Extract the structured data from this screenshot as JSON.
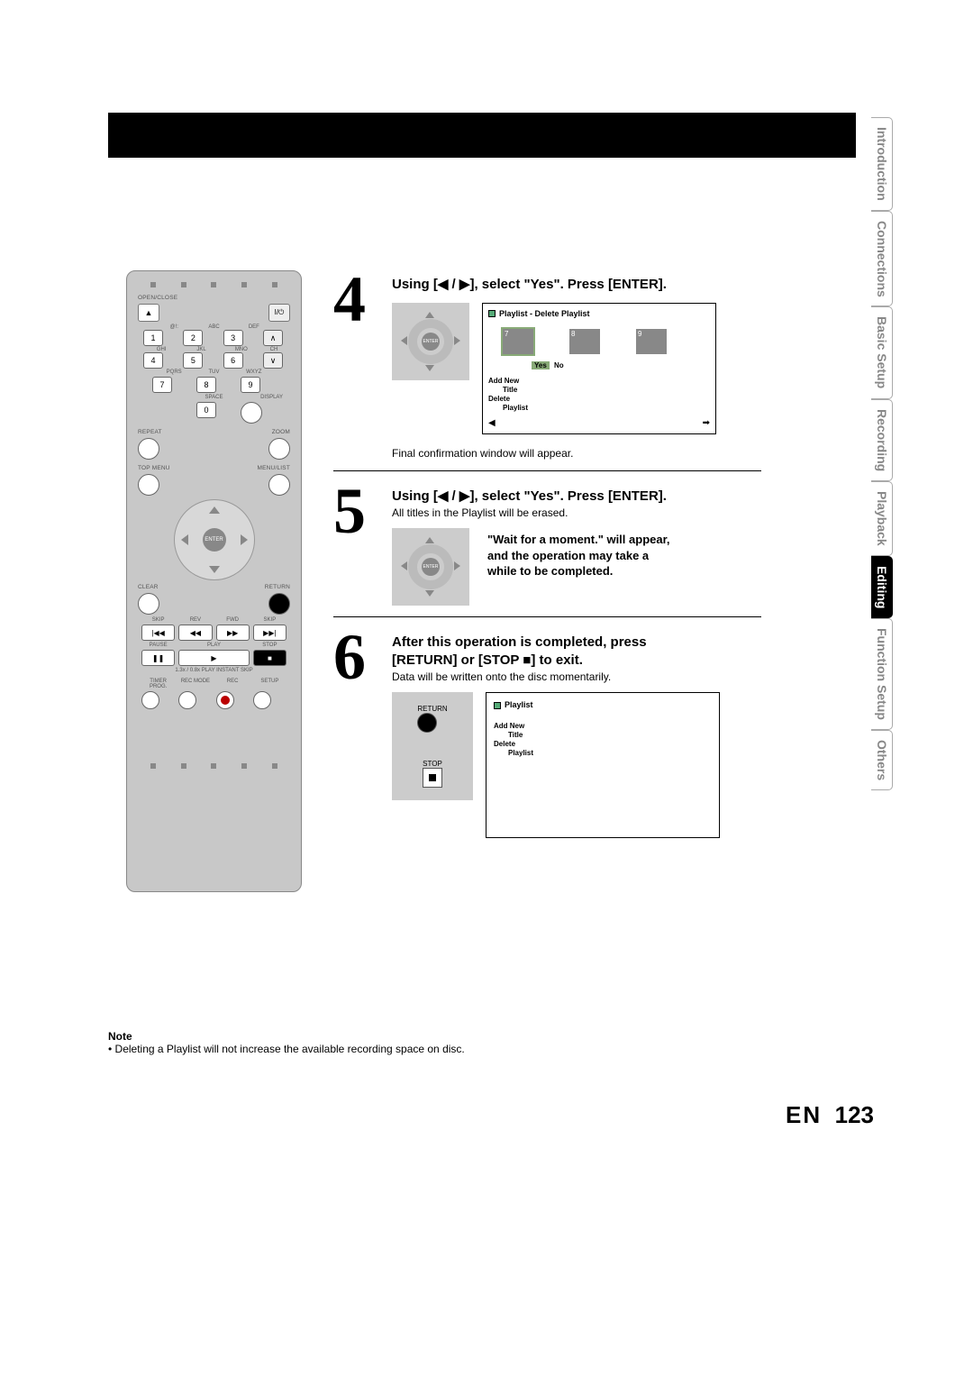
{
  "page": {
    "lang": "EN",
    "number": "123"
  },
  "tabs": {
    "introduction": "Introduction",
    "connections": "Connections",
    "basic_setup": "Basic Setup",
    "recording": "Recording",
    "playback": "Playback",
    "editing": "Editing",
    "function_setup": "Function Setup",
    "others": "Others"
  },
  "steps": {
    "s4": {
      "num": "4",
      "title_pre": "Using [",
      "title_mid": " / ",
      "title_post": "], select \"Yes\". Press [ENTER].",
      "osd_title": "Playlist - Delete Playlist",
      "thumbs": [
        "7",
        "8",
        "9"
      ],
      "yes": "Yes",
      "no": "No",
      "menu1": "Add New",
      "menu1b": "Title",
      "menu2": "Delete",
      "menu2b": "Playlist",
      "conf": "Final confirmation window will appear."
    },
    "s5": {
      "num": "5",
      "title_pre": "Using [",
      "title_mid": " / ",
      "title_post": "], select \"Yes\". Press [ENTER].",
      "sub": "All titles in the Playlist will be erased.",
      "wait1": "\"Wait for a moment.\" will appear,",
      "wait2": "and the operation may take a",
      "wait3": "while to be completed."
    },
    "s6": {
      "num": "6",
      "title1": "After this operation is completed, press",
      "title2_pre": "[RETURN] or [STOP ",
      "title2_post": "] to exit.",
      "sub": "Data will be written onto the disc momentarily.",
      "return": "RETURN",
      "stop": "STOP",
      "osd_title": "Playlist",
      "menu1": "Add New",
      "menu1b": "Title",
      "menu2": "Delete",
      "menu2b": "Playlist"
    }
  },
  "note": {
    "heading": "Note",
    "body": "• Deleting a Playlist will not increase the available recording space on disc."
  },
  "remote": {
    "openclose": "OPEN/CLOSE",
    "row_labels_1": [
      "@!:",
      "ABC",
      "DEF"
    ],
    "row_labels_2": [
      "GHI",
      "JKL",
      "MNO",
      "CH"
    ],
    "row_labels_3": [
      "PQRS",
      "TUV",
      "WXYZ"
    ],
    "space": "SPACE",
    "display": "DISPLAY",
    "nums": [
      "1",
      "2",
      "3",
      "4",
      "5",
      "6",
      "7",
      "8",
      "9",
      "0"
    ],
    "repeat": "REPEAT",
    "zoom": "ZOOM",
    "topmenu": "TOP MENU",
    "menulist": "MENU/LIST",
    "enter": "ENTER",
    "clear": "CLEAR",
    "return": "RETURN",
    "trow1": [
      "SKIP",
      "REV",
      "FWD",
      "SKIP"
    ],
    "t1": [
      "|◀◀",
      "◀◀",
      "▶▶",
      "▶▶|"
    ],
    "trow2": [
      "PAUSE",
      "PLAY",
      "",
      "STOP"
    ],
    "t2": [
      "❚❚",
      "▶",
      "",
      "■"
    ],
    "micro": "1.3x / 0.8x PLAY   INSTANT SKIP",
    "trow3": [
      "TIMER PROG.",
      "REC MODE",
      "REC",
      "SETUP"
    ]
  }
}
